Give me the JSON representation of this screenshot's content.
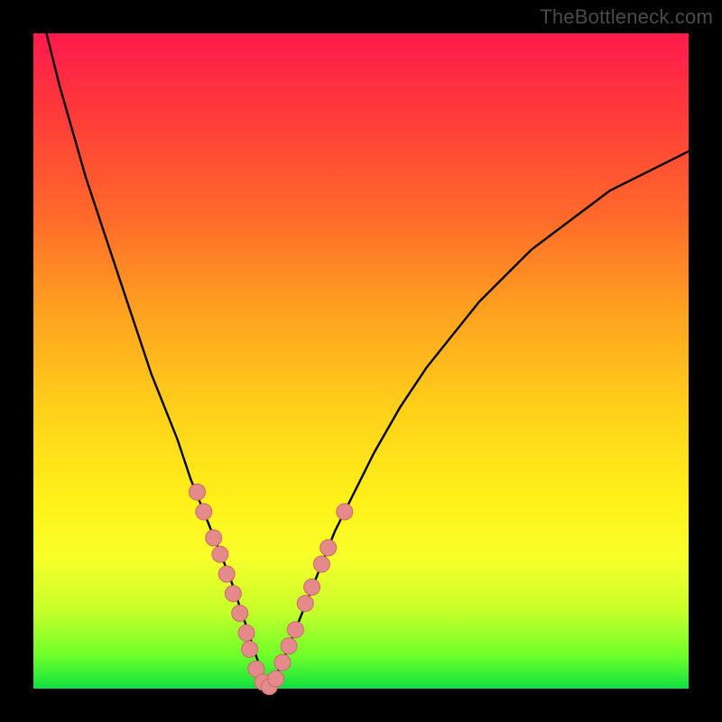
{
  "attribution": "TheBottleneck.com",
  "colors": {
    "frame": "#000000",
    "gradient_top": "#ff1a4d",
    "gradient_bottom": "#10e040",
    "curve": "#000000",
    "dot_fill": "#e58a8a",
    "dot_stroke": "#c96a6a"
  },
  "chart_data": {
    "type": "line",
    "title": "",
    "xlabel": "",
    "ylabel": "",
    "xlim": [
      0,
      100
    ],
    "ylim": [
      0,
      100
    ],
    "series": [
      {
        "name": "bottleneck-curve",
        "x": [
          2,
          4,
          6,
          8,
          10,
          12,
          14,
          16,
          18,
          20,
          22,
          24,
          26,
          28,
          30,
          32,
          33,
          34,
          35,
          36,
          38,
          40,
          42,
          44,
          46,
          48,
          52,
          56,
          60,
          64,
          68,
          72,
          76,
          80,
          84,
          88,
          92,
          96,
          100
        ],
        "y": [
          100,
          92,
          85,
          78,
          72,
          66,
          60,
          54,
          48,
          43,
          38,
          32,
          27,
          22,
          17,
          11,
          8,
          5,
          2,
          0,
          4,
          9,
          14,
          19,
          24,
          28,
          36,
          43,
          49,
          54,
          59,
          63,
          67,
          70,
          73,
          76,
          78,
          80,
          82
        ]
      }
    ],
    "highlight_points": {
      "name": "dots",
      "points": [
        {
          "x": 25.0,
          "y": 30.0
        },
        {
          "x": 26.0,
          "y": 27.0
        },
        {
          "x": 27.5,
          "y": 23.0
        },
        {
          "x": 28.5,
          "y": 20.5
        },
        {
          "x": 29.5,
          "y": 17.5
        },
        {
          "x": 30.5,
          "y": 14.5
        },
        {
          "x": 31.5,
          "y": 11.5
        },
        {
          "x": 32.5,
          "y": 8.5
        },
        {
          "x": 33.0,
          "y": 6.0
        },
        {
          "x": 34.0,
          "y": 3.0
        },
        {
          "x": 35.0,
          "y": 1.0
        },
        {
          "x": 36.0,
          "y": 0.3
        },
        {
          "x": 37.0,
          "y": 1.5
        },
        {
          "x": 38.0,
          "y": 4.0
        },
        {
          "x": 39.0,
          "y": 6.5
        },
        {
          "x": 40.0,
          "y": 9.0
        },
        {
          "x": 41.5,
          "y": 13.0
        },
        {
          "x": 42.5,
          "y": 15.5
        },
        {
          "x": 44.0,
          "y": 19.0
        },
        {
          "x": 45.0,
          "y": 21.5
        },
        {
          "x": 47.5,
          "y": 27.0
        }
      ]
    }
  }
}
